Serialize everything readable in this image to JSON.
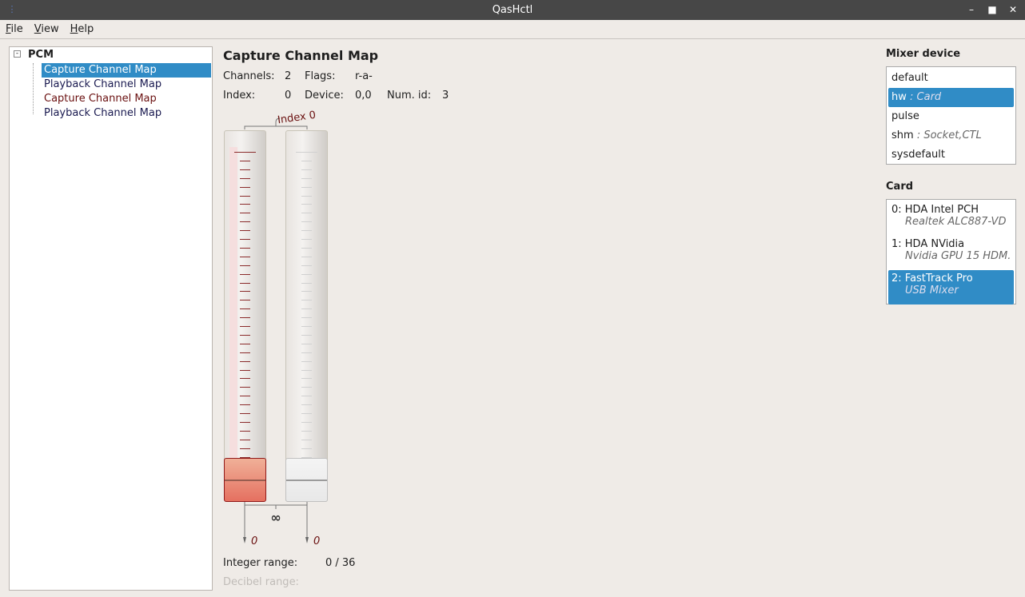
{
  "window": {
    "title": "QasHctl"
  },
  "menu": [
    "File",
    "View",
    "Help"
  ],
  "tree": {
    "root": "PCM",
    "items": [
      {
        "label": "Capture Channel Map",
        "selected": true,
        "style": "selected"
      },
      {
        "label": "Playback Channel Map",
        "style": "blue"
      },
      {
        "label": "Capture Channel Map",
        "style": "red"
      },
      {
        "label": "Playback Channel Map",
        "style": "blue"
      }
    ]
  },
  "main": {
    "title": "Capture Channel Map",
    "channels_label": "Channels:",
    "channels": "2",
    "flags_label": "Flags:",
    "flags": "r-a-",
    "index_label": "Index:",
    "index": "0",
    "device_label": "Device:",
    "device": "0,0",
    "numid_label": "Num. id:",
    "numid": "3",
    "slider_group_label": "Index 0",
    "slider_values": [
      "0",
      "0"
    ],
    "slider_max": 36,
    "int_range_label": "Integer range:",
    "int_range": "0 / 36",
    "db_range_label": "Decibel range:"
  },
  "mixer": {
    "title": "Mixer device",
    "items": [
      {
        "name": "default",
        "note": ""
      },
      {
        "name": "hw",
        "note": " : Card",
        "selected": true
      },
      {
        "name": "pulse",
        "note": ""
      },
      {
        "name": "shm",
        "note": " : Socket,CTL"
      },
      {
        "name": "sysdefault",
        "note": ""
      }
    ]
  },
  "card": {
    "title": "Card",
    "items": [
      {
        "name": "0:  HDA Intel PCH",
        "sub": "Realtek ALC887-VD"
      },
      {
        "name": "1:  HDA NVidia",
        "sub": "Nvidia GPU 15 HDM..."
      },
      {
        "name": "2:  FastTrack Pro",
        "sub": "USB Mixer",
        "selected": true
      }
    ]
  }
}
